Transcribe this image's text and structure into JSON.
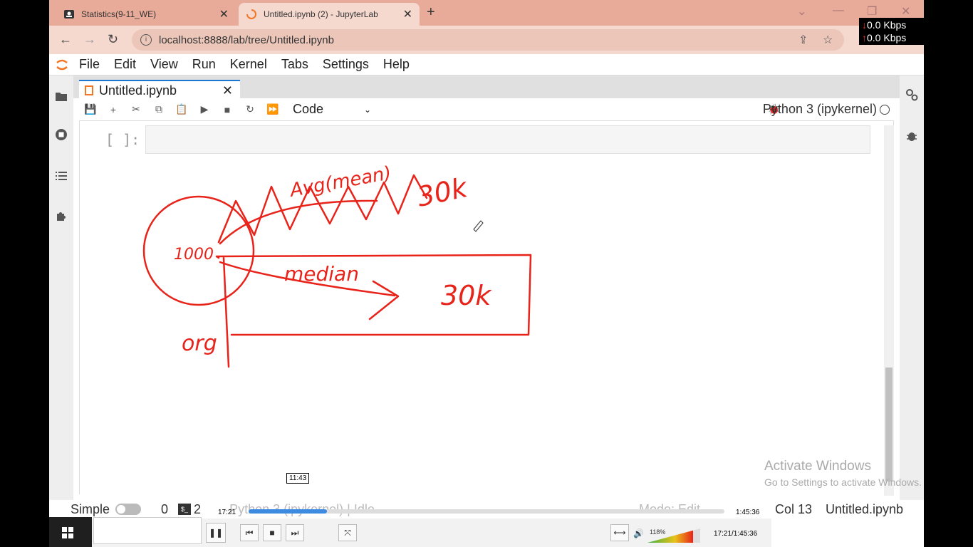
{
  "browser": {
    "tabs": [
      {
        "title": "Statistics(9-11_WE)",
        "active": false
      },
      {
        "title": "Untitled.ipynb (2) - JupyterLab",
        "active": true
      }
    ],
    "url": "localhost:8888/lab/tree/Untitled.ipynb"
  },
  "menu": {
    "items": [
      "File",
      "Edit",
      "View",
      "Run",
      "Kernel",
      "Tabs",
      "Settings",
      "Help"
    ]
  },
  "notebook": {
    "tab_title": "Untitled.ipynb",
    "cell_type": "Code",
    "kernel_name": "Python 3 (ipykernel)",
    "cell_prompt": "[ ]:"
  },
  "annotation": {
    "population_label": "1000",
    "avg_label": "Avg(mean)",
    "avg_value": "30k",
    "median_label": "median",
    "median_value": "30k",
    "org_label": "org"
  },
  "watermark": {
    "line1": "Activate Windows",
    "line2": "Go to Settings to activate Windows."
  },
  "status_bar": {
    "mode_label": "Simple",
    "terminals_count": "0",
    "kernels_count": "2",
    "kernel_status": "Python 3 (ipykernel) | Idle",
    "edit_mode": "Mode: Edit",
    "cursor": "Col 13",
    "file": "Untitled.ipynb"
  },
  "video": {
    "time_elapsed": "17:21",
    "duration": "1:45:36",
    "seek_tooltip": "11:43",
    "volume": "118%",
    "readout": "17:21/1:45:36",
    "progress": 0.164
  },
  "network": {
    "down": "0.0 Kbps",
    "up": "0.0 Kbps"
  },
  "colors": {
    "tabbar": "#e9ab99",
    "jupyter_orange": "#f37626",
    "annotation_red": "#e8231a",
    "seek_blue": "#3d8be0"
  }
}
